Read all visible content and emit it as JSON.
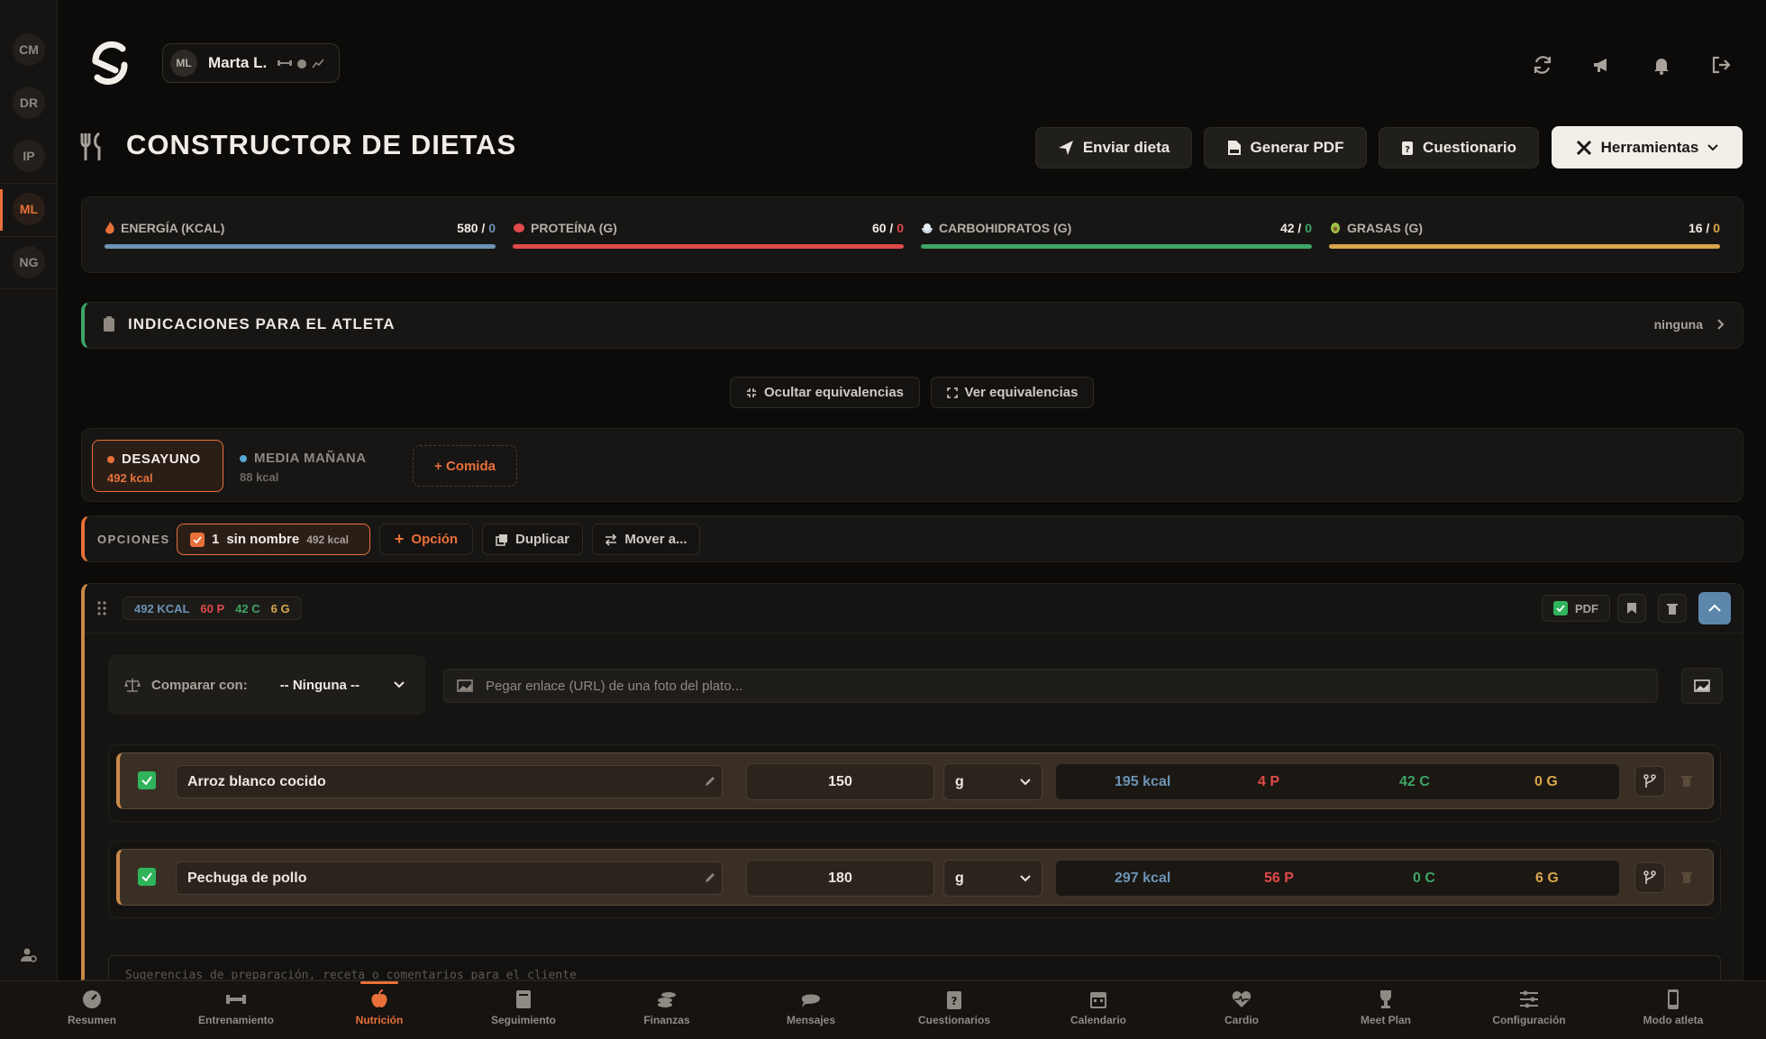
{
  "rail": {
    "avatars": [
      "CM",
      "DR",
      "IP",
      "ML",
      "NG"
    ],
    "active": "ML"
  },
  "athlete": {
    "initials": "ML",
    "name": "Marta L."
  },
  "page_title": "CONSTRUCTOR DE DIETAS",
  "actions": {
    "send": "Enviar dieta",
    "pdf": "Generar PDF",
    "questionnaire": "Cuestionario",
    "tools": "Herramientas"
  },
  "macros": [
    {
      "label": "ENERGÍA (KCAL)",
      "value": "580",
      "target": "0",
      "color": "#6c93b5",
      "progress": 1.0
    },
    {
      "label": "PROTEÍNA (G)",
      "value": "60",
      "target": "0",
      "color": "#e04a4a",
      "progress": 1.0
    },
    {
      "label": "CARBOHIDRATOS (G)",
      "value": "42",
      "target": "0",
      "color": "#3fa566",
      "progress": 1.0
    },
    {
      "label": "GRASAS (G)",
      "value": "16",
      "target": "0",
      "color": "#d9a54c",
      "progress": 1.0
    }
  ],
  "indications": {
    "title": "INDICACIONES PARA EL ATLETA",
    "value": "ninguna"
  },
  "equivalences": {
    "hide": "Ocultar equivalencias",
    "show": "Ver equivalencias"
  },
  "meals": {
    "tabs": [
      {
        "name": "DESAYUNO",
        "kcal": "492 kcal",
        "dot": "#e8703a",
        "active": true
      },
      {
        "name": "MEDIA MAÑANA",
        "kcal": "88 kcal",
        "dot": "#5aa6d6",
        "active": false
      }
    ],
    "add_label": "+ Comida"
  },
  "options": {
    "label": "OPCIONES",
    "selected_num": "1",
    "selected_name": "sin nombre",
    "selected_kcal": "492 kcal",
    "add": "Opción",
    "duplicate": "Duplicar",
    "move": "Mover a..."
  },
  "option_summary": {
    "kcal": "492 KCAL",
    "p": "60 P",
    "c": "42 C",
    "g": "6 G",
    "pdf_label": "PDF"
  },
  "compare": {
    "label": "Comparar con:",
    "selected": "-- Ninguna --"
  },
  "photo_url": {
    "placeholder": "Pegar enlace (URL) de una foto del plato..."
  },
  "foods": [
    {
      "name": "Arroz blanco cocido",
      "qty": "150",
      "unit": "g",
      "kcal": "195 kcal",
      "p": "4 P",
      "c": "42 C",
      "g": "0 G"
    },
    {
      "name": "Pechuga de pollo",
      "qty": "180",
      "unit": "g",
      "kcal": "297 kcal",
      "p": "56 P",
      "c": "0 C",
      "g": "6 G"
    }
  ],
  "notes": {
    "placeholder": "Sugerencias de preparación, receta o comentarios para el cliente"
  },
  "colors": {
    "accent": "#e8703a",
    "kcal": "#6c93b5",
    "protein": "#e04a4a",
    "carbs": "#3fa566",
    "fat": "#d9a54c"
  },
  "bottom_nav": [
    {
      "label": "Resumen",
      "icon": "gauge-icon"
    },
    {
      "label": "Entrenamiento",
      "icon": "dumbbell-icon"
    },
    {
      "label": "Nutrición",
      "icon": "apple-icon",
      "active": true
    },
    {
      "label": "Seguimiento",
      "icon": "book-icon"
    },
    {
      "label": "Finanzas",
      "icon": "coins-icon"
    },
    {
      "label": "Mensajes",
      "icon": "chat-icon"
    },
    {
      "label": "Cuestionarios",
      "icon": "clipboard-question-icon"
    },
    {
      "label": "Calendario",
      "icon": "calendar-icon"
    },
    {
      "label": "Cardio",
      "icon": "heart-pulse-icon"
    },
    {
      "label": "Meet Plan",
      "icon": "trophy-icon"
    },
    {
      "label": "Configuración",
      "icon": "sliders-icon"
    },
    {
      "label": "Modo atleta",
      "icon": "phone-icon"
    }
  ]
}
